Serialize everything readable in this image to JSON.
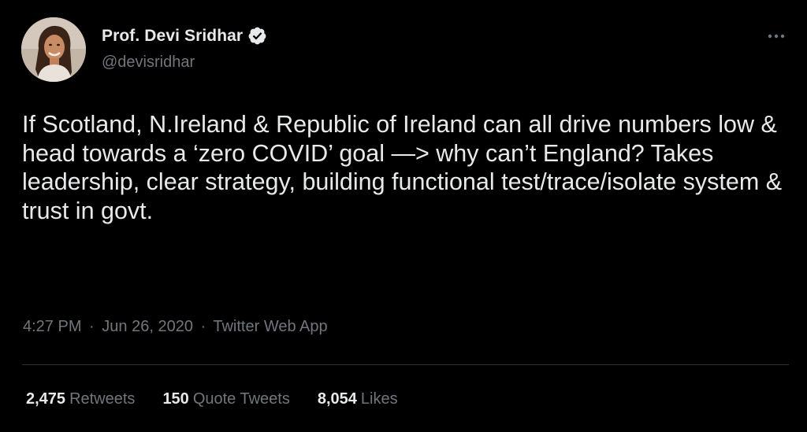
{
  "colors": {
    "background": "#000000",
    "primary_text": "#e7e9ea",
    "secondary_text": "#71767b",
    "divider": "#2f3336",
    "verified_badge": "#1d9bf0"
  },
  "author": {
    "display_name": "Prof. Devi Sridhar",
    "handle": "@devisridhar",
    "avatar_icon": "profile-photo",
    "verified_icon": "verified-badge-icon"
  },
  "header": {
    "more_icon": "more-options-icon"
  },
  "tweet": {
    "text": "If Scotland, N.Ireland & Republic of Ireland can all drive numbers low & head towards a ‘zero COVID’ goal —> why can’t England? Takes leadership, clear strategy, building functional test/trace/isolate system & trust in govt.",
    "time": "4:27 PM",
    "separator": "·",
    "date": "Jun 26, 2020",
    "source": "Twitter Web App"
  },
  "stats": {
    "retweets": {
      "count": "2,475",
      "label": "Retweets"
    },
    "quote_tweets": {
      "count": "150",
      "label": "Quote Tweets"
    },
    "likes": {
      "count": "8,054",
      "label": "Likes"
    }
  }
}
